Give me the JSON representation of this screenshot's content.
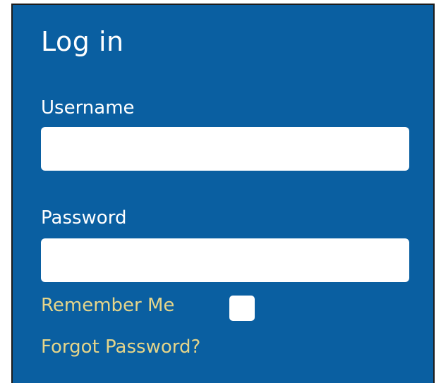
{
  "login": {
    "title": "Log in",
    "username_label": "Username",
    "username_value": "",
    "password_label": "Password",
    "password_value": "",
    "remember_label": "Remember Me",
    "remember_checked": false,
    "forgot_label": "Forgot Password?"
  },
  "colors": {
    "panel_background": "#0a5fa1",
    "link_text": "#e5d58a",
    "label_text": "#ffffff",
    "field_background": "#ffffff"
  }
}
